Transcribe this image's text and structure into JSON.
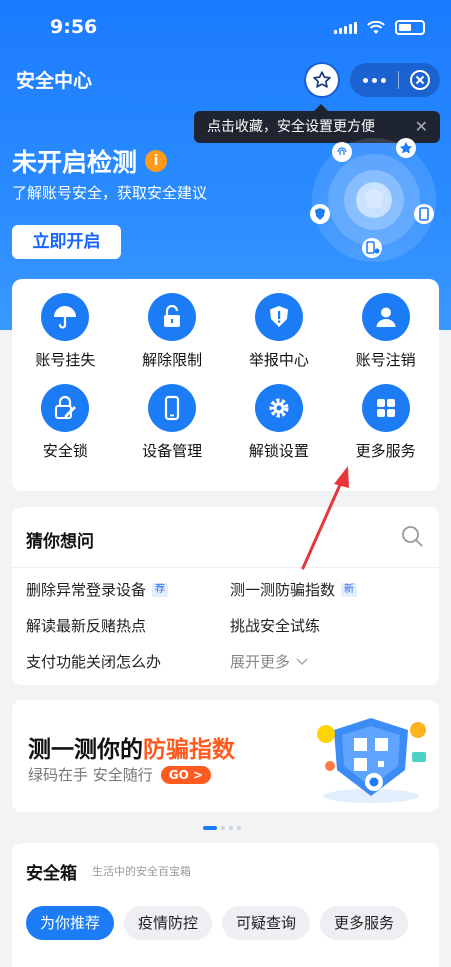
{
  "status_bar": {
    "time": "9:56"
  },
  "nav": {
    "title": "安全中心"
  },
  "tooltip": {
    "text": "点击收藏，安全设置更方便",
    "close": "✕"
  },
  "hero": {
    "title": "未开启检测",
    "info_badge": "i",
    "subtitle": "了解账号安全，获取安全建议",
    "start_button": "立即开启"
  },
  "services": {
    "items": [
      {
        "label": "账号挂失",
        "icon": "umbrella-icon"
      },
      {
        "label": "解除限制",
        "icon": "unlock-icon"
      },
      {
        "label": "举报中心",
        "icon": "report-shield-icon"
      },
      {
        "label": "账号注销",
        "icon": "user-icon"
      },
      {
        "label": "安全锁",
        "icon": "lock-pen-icon"
      },
      {
        "label": "设备管理",
        "icon": "phone-icon"
      },
      {
        "label": "解锁设置",
        "icon": "gear-icon"
      },
      {
        "label": "更多服务",
        "icon": "grid-icon"
      }
    ]
  },
  "guess": {
    "title": "猜你想问",
    "questions": [
      {
        "text": "删除异常登录设备",
        "tag": "荐"
      },
      {
        "text": "测一测防骗指数",
        "tag": "新"
      },
      {
        "text": "解读最新反赌热点"
      },
      {
        "text": "挑战安全试练"
      },
      {
        "text": "支付功能关闭怎么办"
      }
    ],
    "expand": "展开更多"
  },
  "banner": {
    "title_prefix": "测一测你的",
    "title_highlight": "防骗指数",
    "subtitle": "绿码在手 安全随行",
    "go_button": "GO >"
  },
  "safety_box": {
    "title": "安全箱",
    "subtitle": "生活中的安全百宝箱",
    "chips": [
      "为你推荐",
      "疫情防控",
      "可疑查询",
      "更多服务"
    ]
  },
  "colors": {
    "primary": "#1c7cf6",
    "accent": "#ff5a1f",
    "arrow": "#e8363a"
  }
}
